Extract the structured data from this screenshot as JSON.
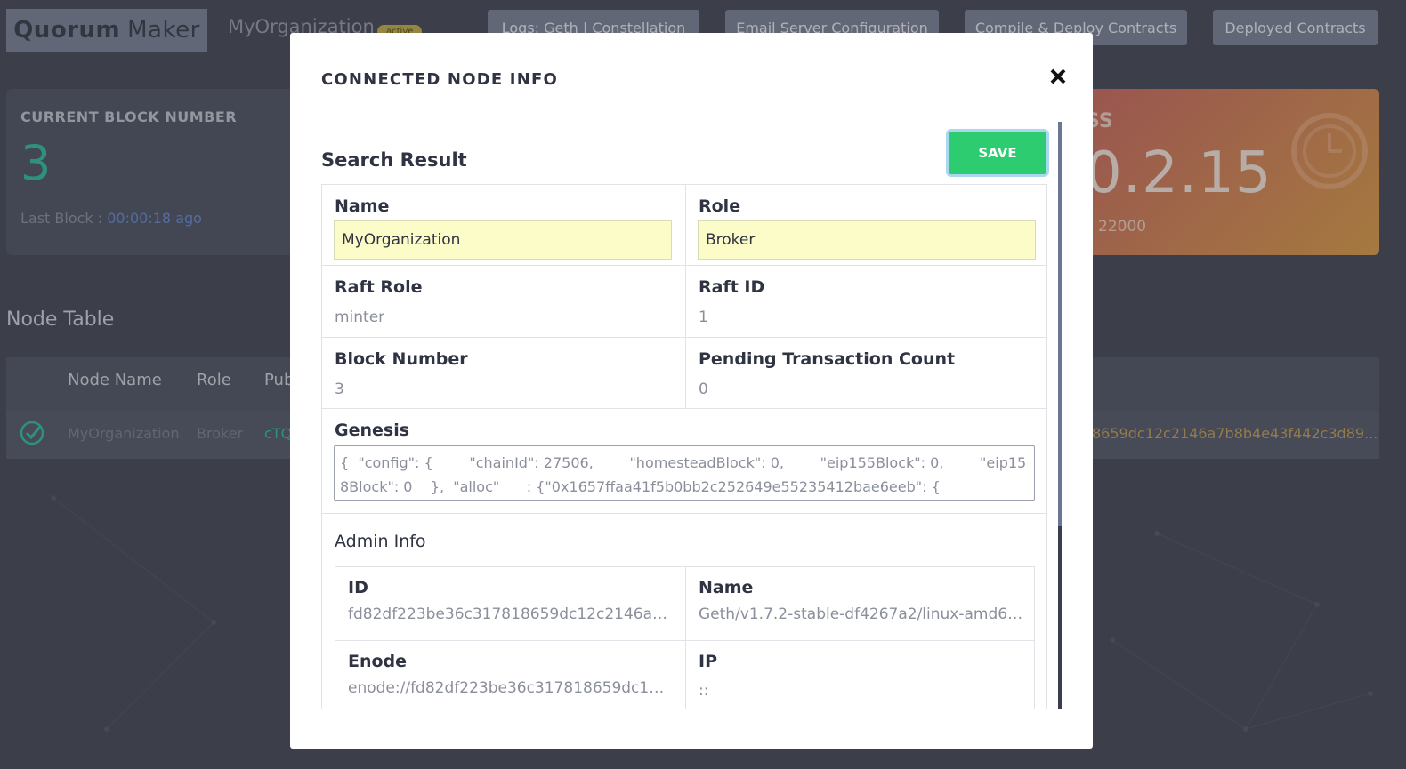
{
  "app": {
    "brand_bold": "Quorum",
    "brand_light": "Maker",
    "org_name": "MyOrganization",
    "status_badge": "active"
  },
  "nav": {
    "logs": "Logs:  Geth | Constellation",
    "email": "Email Server Configuration",
    "compile": "Compile & Deploy Contracts",
    "deployed": "Deployed Contracts"
  },
  "block_card": {
    "title": "CURRENT BLOCK NUMBER",
    "number": "3",
    "last_label": "Last Block : ",
    "last_value": "00:00:18 ago"
  },
  "addr_card": {
    "label_partial": "SS",
    "value_partial": "0.2.15",
    "port": "22000"
  },
  "node_table": {
    "title": "Node Table",
    "headers": [
      "Node Name",
      "Role",
      "Pub"
    ],
    "row": {
      "name": "MyOrganization",
      "role": "Broker",
      "pub_partial": "cTQ",
      "id_partial": "8659dc12c2146a7b8b4e43f442c3d89..."
    }
  },
  "modal": {
    "title": "CONNECTED NODE INFO",
    "search_title": "Search Result",
    "save_label": "SAVE",
    "fields": {
      "name_label": "Name",
      "name_value": "MyOrganization",
      "role_label": "Role",
      "role_value": "Broker",
      "raft_role_label": "Raft Role",
      "raft_role_value": "minter",
      "raft_id_label": "Raft ID",
      "raft_id_value": "1",
      "block_number_label": "Block Number",
      "block_number_value": "3",
      "pending_label": "Pending Transaction Count",
      "pending_value": "0",
      "genesis_label": "Genesis",
      "genesis_value": "{  \"config\": {        \"chainId\": 27506,        \"homesteadBlock\": 0,        \"eip155Block\": 0,        \"eip158Block\": 0    },  \"alloc\"      : {\"0x1657ffaa41f5b0bb2c252649e55235412bae6eeb\": {"
    },
    "admin": {
      "title": "Admin Info",
      "id_label": "ID",
      "id_value": "fd82df223be36c317818659dc12c2146a7b...",
      "name_label": "Name",
      "name_value": "Geth/v1.7.2-stable-df4267a2/linux-amd64/...",
      "enode_label": "Enode",
      "enode_value": "enode://fd82df223be36c317818659dc12c...",
      "ip_label": "IP",
      "ip_value": "::"
    }
  },
  "colors": {
    "accent_green": "#2ecc71",
    "teal": "#35c2a4",
    "input_yellow": "#fbfcc8"
  }
}
